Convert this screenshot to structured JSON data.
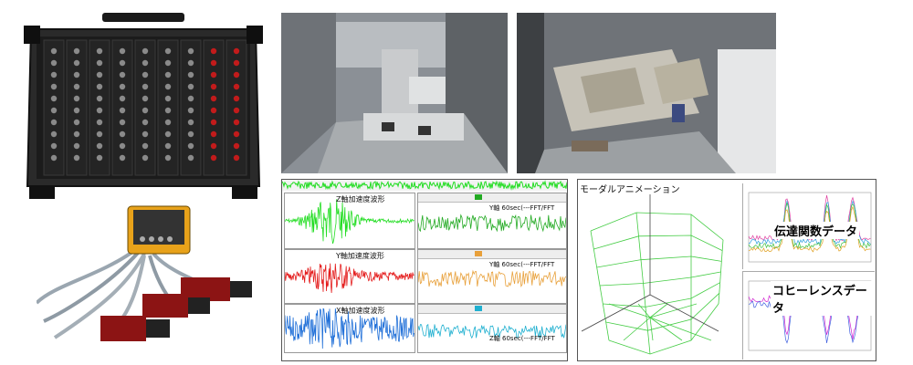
{
  "waveforms": {
    "z_label": "Z軸加速度波形",
    "y_label": "Y軸加速度波形",
    "x_label": "X軸加速度波形",
    "colors": {
      "z": "#22dd22",
      "y": "#e41b1b",
      "x": "#1f6fd8"
    }
  },
  "spectra": [
    {
      "label": "Y軸 60sec(---FFT/FFT",
      "color": "#22aa22"
    },
    {
      "label": "Y軸 60sec(---FFT/FFT",
      "color": "#e8a03a"
    },
    {
      "label": "Z軸 60sec(---FFT/FFT",
      "color": "#20b0d0"
    }
  ],
  "modal": {
    "title": "モーダルアニメーション",
    "transfer_label": "伝達関数データ",
    "coherence_label": "コヒーレンスデータ"
  }
}
